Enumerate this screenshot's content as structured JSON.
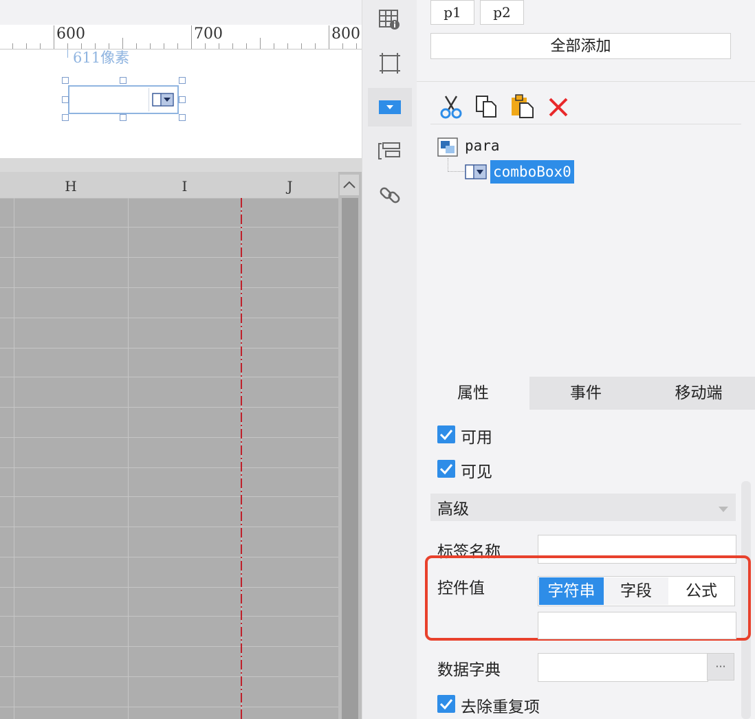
{
  "ruler": {
    "ticks": [
      "600",
      "700",
      "800"
    ],
    "position_readout": "611像素"
  },
  "spreadsheet": {
    "columns": [
      "H",
      "I",
      "J"
    ]
  },
  "params": {
    "buttons": [
      "p1",
      "p2"
    ],
    "add_all": "全部添加"
  },
  "widget_tree": {
    "root": "para",
    "child": "comboBox0"
  },
  "tabs": [
    "属性",
    "事件",
    "移动端"
  ],
  "properties": {
    "enabled": "可用",
    "visible": "可见",
    "advanced": "高级",
    "label_name": "标签名称",
    "control_value": "控件值",
    "value_types": [
      "字符串",
      "字段",
      "公式"
    ],
    "data_dictionary": "数据字典",
    "dict_button": "···",
    "dedupe": "去除重复项"
  },
  "colors": {
    "accent": "#2e8de8",
    "highlight_box": "#e8412c",
    "grid_bg": "#aeaeae",
    "selection": "#8fb4e0"
  }
}
